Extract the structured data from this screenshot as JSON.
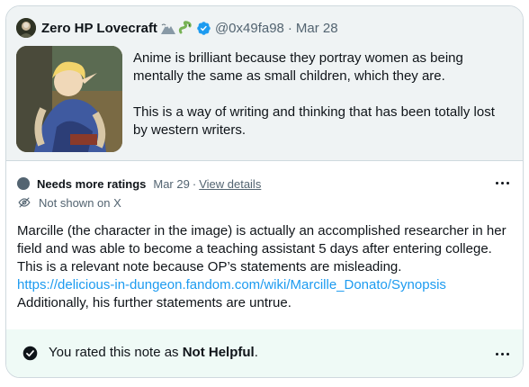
{
  "tweet": {
    "author_name": "Zero HP Lovecraft",
    "handle": "@0x49fa98",
    "separator": "·",
    "date": "Mar 28",
    "paragraphs": [
      "Anime is brilliant because they portray women as being mentally the same as small children, which they are.",
      "This is a way of writing and thinking that has been totally lost by western writers."
    ]
  },
  "note": {
    "status": "Needs more ratings",
    "date": "Mar 29",
    "separator": "·",
    "view_details": "View details",
    "visibility": "Not shown on X",
    "body": "Marcille (the character in the image) is actually an accomplished researcher in her field and was able to become a teaching assistant 5 days after entering college. This is a relevant note because OP’s statements are misleading.",
    "link": "https://delicious-in-dungeon.fandom.com/wiki/Marcille_Donato/Synopsis",
    "body_after": "Additionally, his further statements are untrue."
  },
  "rating": {
    "prefix": "You rated this note as ",
    "value": "Not Helpful",
    "suffix": "."
  },
  "colors": {
    "accent": "#1d9bf0",
    "muted_text": "#536471",
    "tweet_bg": "#eff3f4",
    "rating_bg": "#effaf6",
    "border": "#cfd9de"
  },
  "icons": [
    "mountain-emoji-icon",
    "snake-emoji-icon",
    "verified-badge-icon",
    "eye-slash-icon",
    "check-circle-icon",
    "more-icon"
  ]
}
